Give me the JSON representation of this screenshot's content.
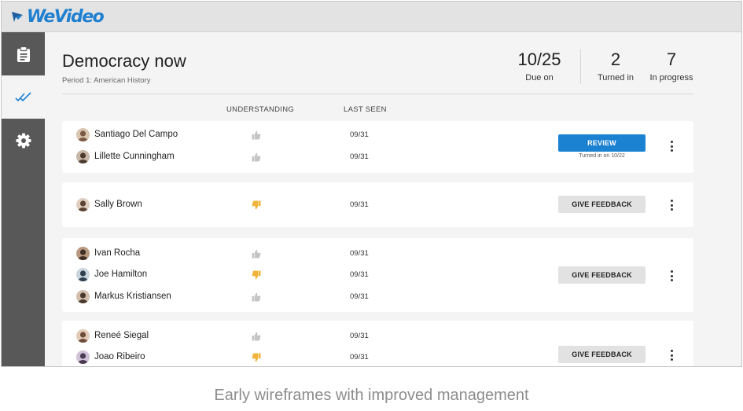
{
  "app": {
    "logo_text": "WeVideo"
  },
  "sidebar": {
    "items": [
      {
        "icon": "clipboard-icon"
      },
      {
        "icon": "double-check-icon",
        "active": true
      },
      {
        "icon": "gear-icon"
      }
    ]
  },
  "assignment": {
    "title": "Democracy now",
    "subtitle": "Period 1: American History",
    "stats": [
      {
        "value": "10/25",
        "label": "Due on"
      },
      {
        "value": "2",
        "label": "Turned in"
      },
      {
        "value": "7",
        "label": "In progress"
      }
    ]
  },
  "columns": {
    "understanding": "UNDERSTANDING",
    "last_seen": "LAST SEEN"
  },
  "groups": [
    {
      "students": [
        {
          "name": "Santiago Del Campo",
          "understanding": "up",
          "last_seen": "09/31"
        },
        {
          "name": "Lillette Cunningham",
          "understanding": "up",
          "last_seen": "09/31"
        }
      ],
      "action": {
        "label": "REVIEW",
        "type": "review"
      },
      "note": "Turned in on 10/22"
    },
    {
      "students": [
        {
          "name": "Sally Brown",
          "understanding": "down",
          "last_seen": "09/31"
        }
      ],
      "action": {
        "label": "GIVE FEEDBACK",
        "type": "feedback"
      }
    },
    {
      "students": [
        {
          "name": "Ivan Rocha",
          "understanding": "up",
          "last_seen": "09/31"
        },
        {
          "name": "Joe Hamilton",
          "understanding": "down",
          "last_seen": "09/31"
        },
        {
          "name": "Markus Kristiansen",
          "understanding": "up",
          "last_seen": "09/31"
        }
      ],
      "action": {
        "label": "GIVE FEEDBACK",
        "type": "feedback"
      }
    },
    {
      "students": [
        {
          "name": "Reneé Siegal",
          "understanding": "up",
          "last_seen": "09/31"
        },
        {
          "name": "Joao Ribeiro",
          "understanding": "down",
          "last_seen": "09/31"
        }
      ],
      "action": {
        "label": "GIVE FEEDBACK",
        "type": "feedback"
      }
    }
  ],
  "colors": {
    "accent": "#1b82d2",
    "thumb_up": "#c4c4c4",
    "thumb_down": "#f0b43a",
    "sidebar": "#585858"
  },
  "caption": "Early wireframes with improved management"
}
